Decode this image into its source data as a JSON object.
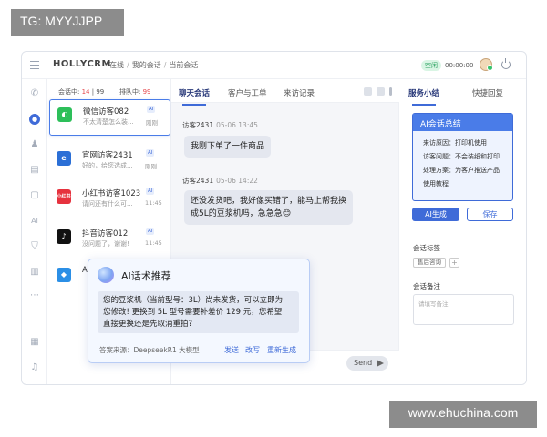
{
  "watermarks": {
    "top_left": "TG: MYYJJPP",
    "bottom_right": "www.ehuchina.com"
  },
  "header": {
    "logo": "HOLLYCRM",
    "breadcrumb": [
      "在线",
      "我的会话",
      "当前会话"
    ],
    "status": "空闲",
    "timer": "00:00:00"
  },
  "sidebar": {
    "icons": [
      "menu-icon",
      "phone-icon",
      "chat-icon",
      "user-icon",
      "briefcase-icon",
      "message-icon",
      "ai-icon",
      "shield-icon",
      "bar-chart-icon",
      "more-icon",
      "book-icon",
      "bell-icon"
    ]
  },
  "conversation_list": {
    "session_label": "会话中:",
    "session_current": "14",
    "session_total": "99",
    "queue_label": "排队中:",
    "queue_count": "99",
    "items": [
      {
        "name": "微信访客082",
        "tag": "AI",
        "preview": "不太清楚怎么装...",
        "time": "刚刚",
        "channel": "wechat-icon",
        "color": "#2dbf5a"
      },
      {
        "name": "官网访客2431",
        "tag": "AI",
        "preview": "好的，给您选成...",
        "time": "刚刚",
        "channel": "ie-icon",
        "color": "#2b6fd6"
      },
      {
        "name": "小红书访客1023",
        "tag": "AI",
        "preview": "请问还有什么可...",
        "time": "11:45",
        "channel": "xiaohongshu-icon",
        "color": "#e6323e"
      },
      {
        "name": "抖音访客012",
        "tag": "AI",
        "preview": "没问题了，谢谢!",
        "time": "11:45",
        "channel": "tiktok-icon",
        "color": "#111111"
      },
      {
        "name": "A",
        "tag": "",
        "preview": "",
        "time": "",
        "channel": "cube-icon",
        "color": "#2b8fe6"
      }
    ]
  },
  "chat": {
    "tabs": [
      "聊天会话",
      "客户与工单",
      "来访记录"
    ],
    "messages": [
      {
        "sender": "访客2431",
        "time": "05-06 13:45",
        "lines": [
          "我刚下单了一件商品"
        ]
      },
      {
        "sender": "访客2431",
        "time": "05-06 14:22",
        "lines": [
          "还没发货吧，我好像买错了，能马上帮我换",
          "成5L的豆浆机吗，急急急😊"
        ]
      }
    ],
    "send_label": "Send"
  },
  "ai_popup": {
    "title": "AI话术推荐",
    "body": [
      "您的豆浆机（当前型号：3L）尚未发货，可以立即为",
      "您修改! 更换到 5L 型号需要补差价 129 元，您希望",
      "直接更换还是先取消重拍?"
    ],
    "source": "答案来源：DeepseekR1 大模型",
    "actions": [
      "发送",
      "改写",
      "重新生成"
    ]
  },
  "right_panel": {
    "tabs": [
      "服务小结",
      "快捷回复"
    ],
    "summary_title": "AI会话总结",
    "summary_lines": [
      "来访原因：打印机使用",
      "访客问题：不会装纸和打印",
      "处理方案：为客户推送产品",
      "使用教程"
    ],
    "ai_button": "AI生成",
    "save_button": "保存",
    "tags_label": "会话标签",
    "tag": "售后咨询",
    "tag_add": "+",
    "notes_label": "会话备注",
    "notes_placeholder": "请填写备注"
  }
}
